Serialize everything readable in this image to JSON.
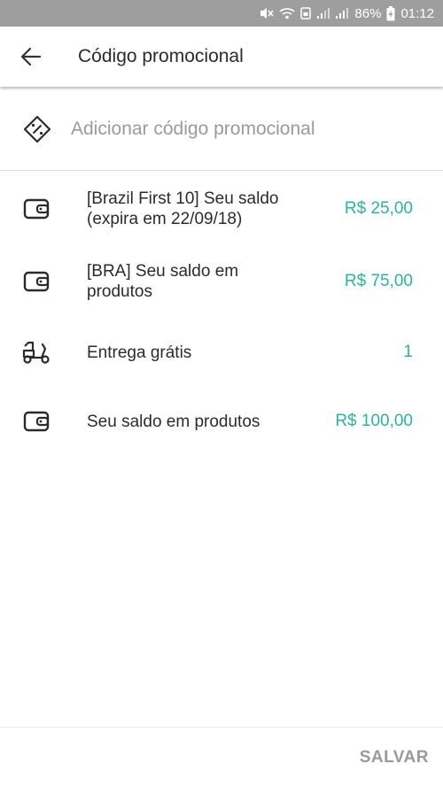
{
  "status_bar": {
    "battery": "86%",
    "time": "01:12"
  },
  "header": {
    "title": "Código promocional"
  },
  "promo_input": {
    "placeholder": "Adicionar código promocional"
  },
  "list": {
    "items": [
      {
        "icon": "wallet-icon",
        "line1": "[Brazil First 10] Seu saldo",
        "line2": "(expira em 22/09/18)",
        "value": "R$ 25,00"
      },
      {
        "icon": "wallet-icon",
        "line1": "[BRA] Seu saldo em",
        "line2": "produtos",
        "value": "R$ 75,00"
      },
      {
        "icon": "scooter-icon",
        "line1": "Entrega grátis",
        "line2": "",
        "value": "1"
      },
      {
        "icon": "wallet-icon",
        "line1": "Seu saldo em produtos",
        "line2": "",
        "value": "R$ 100,00"
      }
    ]
  },
  "footer": {
    "save_label": "SALVAR"
  },
  "colors": {
    "accent": "#2bb59a",
    "status_bar": "#9e9e9e",
    "muted": "#9a9a9a"
  }
}
